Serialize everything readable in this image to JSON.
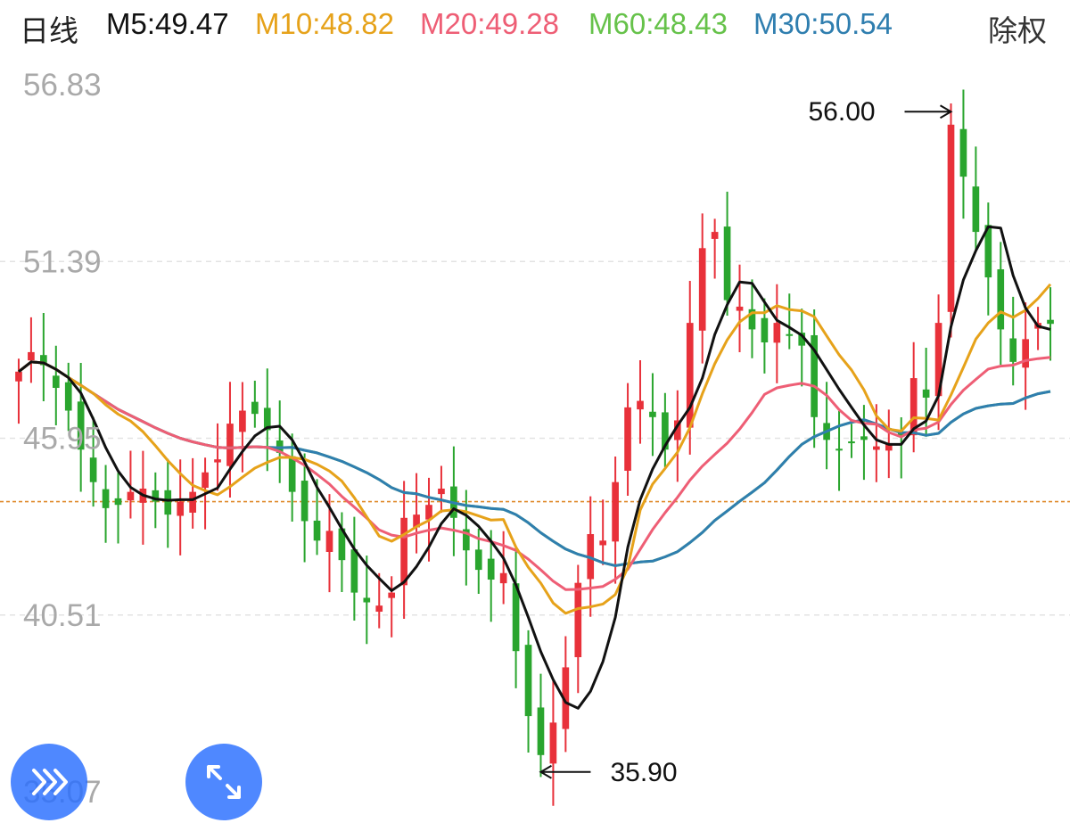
{
  "header": {
    "period": "日线",
    "mas": [
      {
        "label": "M5:49.47",
        "color": "#111111"
      },
      {
        "label": "M10:48.82",
        "color": "#e6a21a"
      },
      {
        "label": "M20:49.28",
        "color": "#ee5e75"
      },
      {
        "label": "M60:48.43",
        "color": "#66c24a"
      },
      {
        "label": "M30:50.54",
        "color": "#2f7eaf"
      }
    ],
    "right_button": "除权"
  },
  "chart_data": {
    "type": "candlestick",
    "y_ticks": [
      "56.83",
      "51.39",
      "45.95",
      "40.51",
      "35.07"
    ],
    "ylim": [
      35.07,
      56.83
    ],
    "dashed_ref_value": 44.0,
    "max_annotation": "56.00",
    "min_annotation": "35.90",
    "colors": {
      "up": "#e8313a",
      "down": "#2aa52e",
      "ma5": "#111111",
      "ma10": "#e6a21a",
      "ma20": "#ee5e75",
      "ma30": "#2f7eaf",
      "ma60": "#66c24a",
      "ref_line": "#e08a2c",
      "grid": "#e3e3e3"
    },
    "closes": [
      48.0,
      48.6,
      48.2,
      47.5,
      46.8,
      45.6,
      44.6,
      43.8,
      43.9,
      44.3,
      44.4,
      44.0,
      43.6,
      44.0,
      44.3,
      44.9,
      45.3,
      46.4,
      46.8,
      46.7,
      46.2,
      45.5,
      44.3,
      43.4,
      42.8,
      43.1,
      42.2,
      41.2,
      40.9,
      40.8,
      41.2,
      43.5,
      43.6,
      43.9,
      44.4,
      43.5,
      42.5,
      41.9,
      41.6,
      41.8,
      39.4,
      37.4,
      36.2,
      37.2,
      38.9,
      41.5,
      43.0,
      42.8,
      44.6,
      46.9,
      47.1,
      46.6,
      45.6,
      46.5,
      49.5,
      51.8,
      52.3,
      50.2,
      50.0,
      49.3,
      48.9,
      49.5,
      49.1,
      48.8,
      46.6,
      45.9,
      45.6,
      45.8,
      45.9,
      45.7,
      45.8,
      46.0,
      47.8,
      47.2,
      49.5,
      55.6,
      54.0,
      52.3,
      50.9,
      49.3,
      48.3,
      49.0,
      49.5,
      49.47
    ],
    "ma5": [
      48.0,
      48.3,
      48.27,
      48.07,
      47.82,
      47.34,
      46.54,
      45.66,
      44.94,
      44.44,
      44.2,
      44.08,
      44.04,
      44.06,
      44.06,
      44.24,
      44.42,
      45.0,
      45.54,
      46.02,
      46.28,
      46.32,
      45.9,
      45.22,
      44.44,
      43.82,
      43.16,
      42.54,
      42.04,
      41.64,
      41.26,
      41.52,
      42.0,
      42.6,
      43.32,
      43.78,
      43.58,
      43.24,
      42.78,
      42.26,
      41.44,
      40.44,
      39.38,
      38.52,
      37.82,
      37.64,
      38.16,
      39.08,
      40.44,
      42.6,
      44.06,
      45.0,
      45.72,
      46.34,
      46.9,
      47.8,
      49.14,
      50.06,
      50.76,
      50.72,
      50.14,
      49.58,
      49.36,
      49.12,
      48.66,
      48.06,
      47.46,
      46.9,
      46.36,
      45.9,
      45.76,
      45.76,
      46.24,
      46.48,
      47.26,
      49.38,
      50.82,
      51.72,
      52.46,
      52.42,
      50.96,
      49.96,
      49.4,
      49.3
    ],
    "ma10": [
      48.0,
      48.3,
      48.27,
      48.07,
      47.82,
      47.58,
      47.33,
      46.98,
      46.69,
      46.48,
      46.15,
      45.72,
      45.26,
      44.86,
      44.5,
      44.34,
      44.21,
      44.46,
      44.75,
      45.03,
      45.21,
      45.36,
      45.36,
      45.3,
      45.15,
      44.94,
      44.63,
      44.12,
      43.53,
      42.94,
      42.78,
      42.99,
      43.23,
      43.42,
      43.71,
      43.75,
      43.69,
      43.56,
      43.43,
      43.45,
      42.6,
      41.98,
      41.49,
      40.88,
      40.56,
      40.71,
      40.76,
      40.85,
      41.14,
      41.97,
      43.74,
      44.54,
      45.02,
      45.52,
      46.28,
      47.32,
      48.24,
      48.98,
      49.53,
      49.81,
      49.81,
      50.03,
      49.91,
      49.87,
      49.69,
      49.1,
      48.52,
      48.05,
      47.44,
      46.64,
      46.23,
      46.17,
      46.58,
      46.56,
      46.51,
      47.28,
      48.13,
      49.0,
      49.5,
      49.84,
      49.67,
      49.89,
      50.25,
      50.69
    ],
    "ma20": [
      48.0,
      48.3,
      48.27,
      48.07,
      47.82,
      47.58,
      47.33,
      47.08,
      46.84,
      46.65,
      46.46,
      46.27,
      46.1,
      45.95,
      45.84,
      45.75,
      45.67,
      45.65,
      45.67,
      45.69,
      45.67,
      45.54,
      45.34,
      45.12,
      44.84,
      44.54,
      44.16,
      43.83,
      43.49,
      43.13,
      42.97,
      42.91,
      43.03,
      43.12,
      43.19,
      43.12,
      43.03,
      42.86,
      42.77,
      42.65,
      42.5,
      42.23,
      41.9,
      41.55,
      41.29,
      41.3,
      41.34,
      41.39,
      41.61,
      41.92,
      42.53,
      43.14,
      43.66,
      44.13,
      44.66,
      45.09,
      45.45,
      45.8,
      46.23,
      46.74,
      47.3,
      47.5,
      47.58,
      47.64,
      47.55,
      47.27,
      46.83,
      46.5,
      46.41,
      46.38,
      46.13,
      45.99,
      46.21,
      46.26,
      46.45,
      46.99,
      47.43,
      47.76,
      48.08,
      48.17,
      48.2,
      48.34,
      48.4,
      48.44
    ],
    "ma30": [
      48.0,
      48.3,
      48.27,
      48.07,
      47.82,
      47.58,
      47.33,
      47.08,
      46.84,
      46.65,
      46.46,
      46.27,
      46.1,
      45.95,
      45.84,
      45.75,
      45.67,
      45.65,
      45.67,
      45.69,
      45.67,
      45.66,
      45.67,
      45.58,
      45.5,
      45.37,
      45.24,
      45.07,
      44.89,
      44.68,
      44.43,
      44.28,
      44.24,
      44.13,
      44.05,
      43.96,
      43.88,
      43.84,
      43.79,
      43.76,
      43.6,
      43.35,
      43.04,
      42.78,
      42.54,
      42.38,
      42.27,
      42.12,
      42.03,
      42.09,
      42.14,
      42.17,
      42.3,
      42.46,
      42.74,
      43.05,
      43.42,
      43.71,
      44.01,
      44.29,
      44.58,
      44.97,
      45.39,
      45.76,
      46.0,
      46.16,
      46.33,
      46.44,
      46.52,
      46.39,
      46.24,
      46.12,
      46.12,
      46.04,
      46.1,
      46.44,
      46.7,
      46.87,
      46.95,
      47.0,
      47.02,
      47.19,
      47.32,
      47.39
    ],
    "ma60": [
      48.0,
      48.3,
      48.27,
      48.07,
      47.82,
      47.58,
      47.33,
      47.08,
      46.84,
      46.65,
      46.46,
      46.27,
      46.1,
      45.95,
      45.84,
      45.75,
      45.67,
      45.65,
      45.67,
      45.69,
      45.67,
      45.66,
      45.67,
      45.58,
      45.5,
      45.37,
      45.24,
      45.07,
      44.89,
      44.68,
      44.43,
      44.28,
      44.24,
      44.13,
      44.05,
      43.96,
      43.88,
      43.84,
      43.79,
      43.76,
      43.6,
      43.35,
      43.04,
      42.78,
      42.54,
      42.38,
      42.27,
      42.12,
      42.03,
      42.09,
      42.14,
      42.17,
      42.3,
      42.46,
      42.74,
      43.05,
      43.42,
      43.71,
      44.01,
      44.29,
      44.58,
      44.97,
      45.39,
      45.76,
      46.0,
      46.16,
      46.33,
      46.44,
      46.52,
      46.39,
      46.24,
      46.12,
      46.12,
      46.04,
      46.1,
      46.44,
      46.7,
      46.87,
      46.95,
      47.0,
      47.02,
      47.19,
      47.32,
      47.39
    ]
  }
}
